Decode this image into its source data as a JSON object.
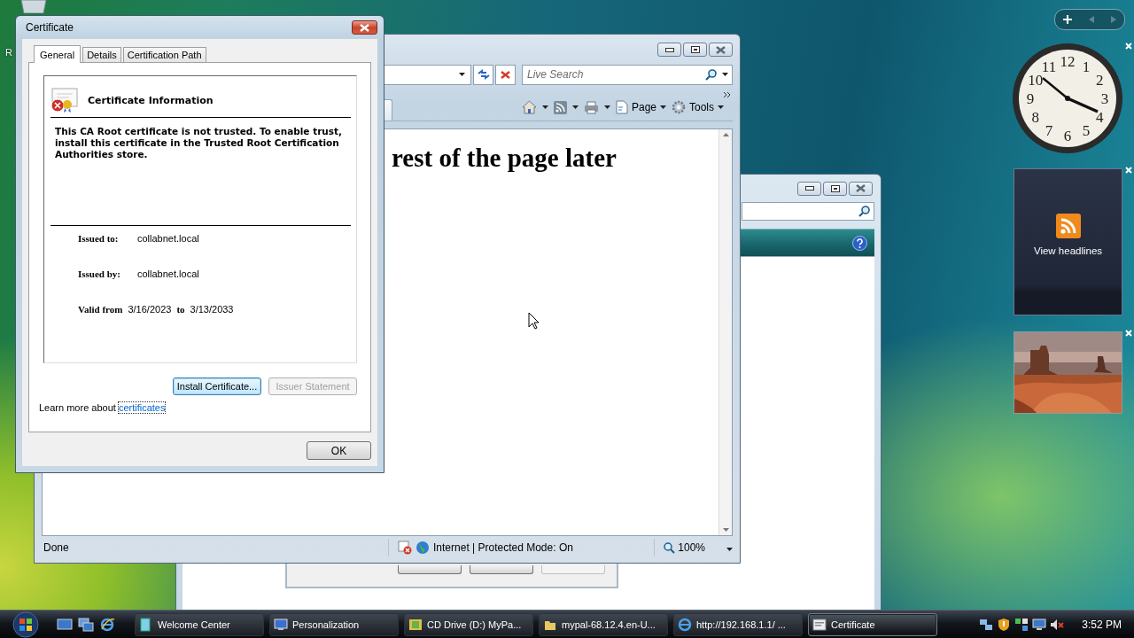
{
  "desktop": {
    "icon_label": "R"
  },
  "dialog": {
    "title": "Certificate",
    "tabs": [
      {
        "label": "General",
        "selected": true
      },
      {
        "label": "Details",
        "selected": false
      },
      {
        "label": "Certification Path",
        "selected": false
      }
    ],
    "info_title": "Certificate Information",
    "message": "This CA Root certificate is not trusted. To enable trust, install this certificate in the Trusted Root Certification Authorities store.",
    "fields": [
      {
        "label": "Issued to:",
        "value": "collabnet.local"
      },
      {
        "label": "Issued by:",
        "value": "collabnet.local"
      }
    ],
    "validity": {
      "label": "Valid from",
      "from": "3/16/2023",
      "to_label": "to",
      "to": "3/13/2033"
    },
    "buttons": [
      {
        "label": "Install Certificate...",
        "disabled": false,
        "focused": true
      },
      {
        "label": "Issuer Statement",
        "disabled": true,
        "focused": false
      }
    ],
    "learn_more": {
      "text": "Learn more about",
      "link": "certificates"
    },
    "ok": "OK"
  },
  "browser": {
    "search": {
      "placeholder": "Live Search"
    },
    "toolbar": [
      "Page",
      "Tools"
    ],
    "heading": "rest of the page later",
    "status_bar": {
      "status": "Done",
      "zone": "Internet | Protected Mode: On",
      "zoom": "100%"
    }
  },
  "back_dialog": {
    "buttons": [
      {
        "disabled": false
      },
      {
        "disabled": false
      },
      {
        "disabled": true
      }
    ]
  },
  "gadgets": {
    "clock": {
      "numerals": [
        "11",
        "12",
        "1",
        "10",
        "2",
        "9",
        "3",
        "8",
        "4",
        "7",
        "6",
        "5"
      ]
    },
    "feed": {
      "label": "View headlines"
    }
  },
  "taskbar": {
    "tasks": [
      {
        "label": "Welcome Center",
        "selected": false
      },
      {
        "label": "Personalization",
        "selected": false
      },
      {
        "label": "CD Drive (D:) MyPa...",
        "selected": false
      },
      {
        "label": "mypal-68.12.4.en-U...",
        "selected": false
      },
      {
        "label": "http://192.168.1.1/ ...",
        "selected": false
      },
      {
        "label": "Certificate",
        "selected": true
      }
    ],
    "time": "3:52 PM"
  }
}
